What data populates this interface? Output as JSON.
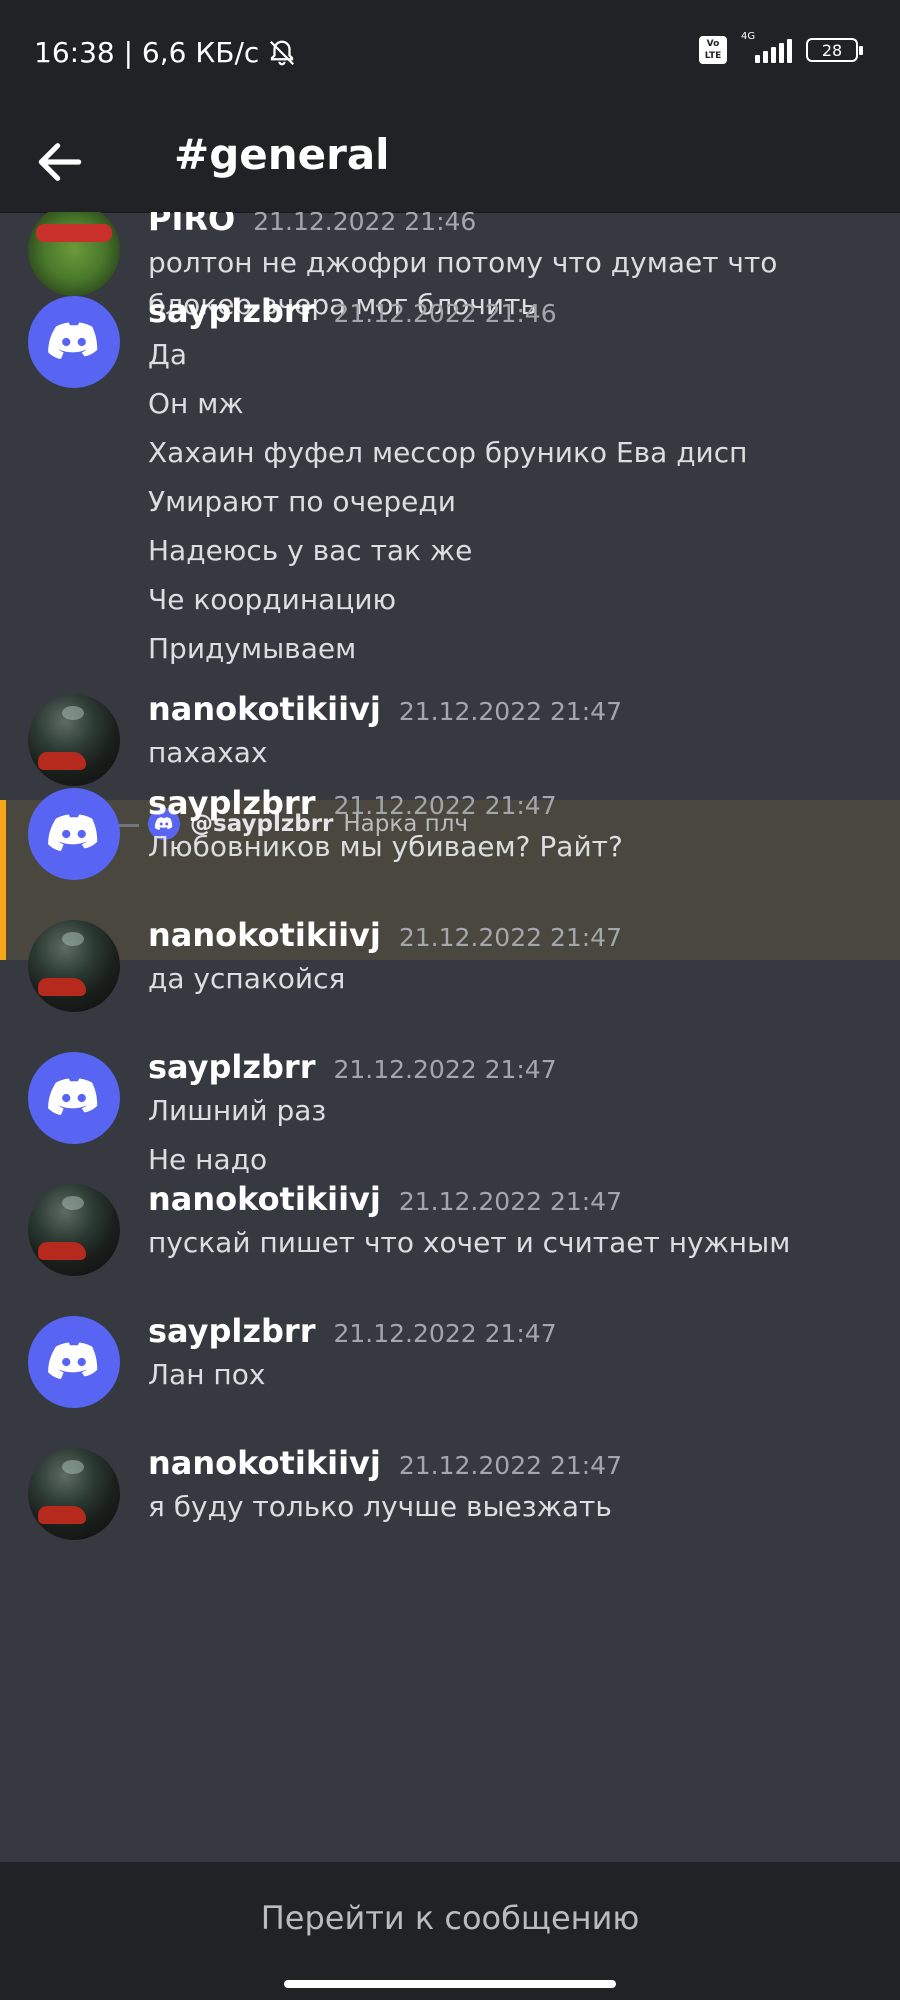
{
  "status_bar": {
    "time_speed": "16:38 | 6,6 КБ/с",
    "network": "4G",
    "volte": "Vo LTE",
    "battery": "28"
  },
  "header": {
    "channel": "#general"
  },
  "reply": {
    "user": "@sayplzbrr",
    "text": "Нарка плч"
  },
  "messages": [
    {
      "user": "PIRO",
      "time": "21.12.2022 21:46",
      "avatar": "piro-avatar",
      "lines": [
        "ролтон не джофри потому что думает что",
        "блокер вчера мог блочить"
      ]
    },
    {
      "user": "sayplzbrr",
      "time": "21.12.2022 21:46",
      "avatar": "discord-logo",
      "lines": [
        "Да",
        "Он мж",
        "Хахаин фуфел мессор брунико Ева дисп",
        "Умирают по очереди",
        "Надеюсь у вас так же",
        "Че координацию",
        "Придумываем"
      ]
    },
    {
      "user": "nanokotikiivj",
      "time": "21.12.2022 21:47",
      "avatar": "car-night-avatar",
      "lines": [
        "пахахах"
      ]
    },
    {
      "user": "sayplzbrr",
      "time": "21.12.2022 21:47",
      "avatar": "discord-logo",
      "lines": [
        "Любовников мы убиваем? Райт?"
      ]
    },
    {
      "user": "nanokotikiivj",
      "time": "21.12.2022 21:47",
      "avatar": "car-night-avatar",
      "lines": [
        "да успакойся"
      ]
    },
    {
      "user": "sayplzbrr",
      "time": "21.12.2022 21:47",
      "avatar": "discord-logo",
      "lines": [
        "Лишний раз",
        "Не надо"
      ]
    },
    {
      "user": "nanokotikiivj",
      "time": "21.12.2022 21:47",
      "avatar": "car-night-avatar",
      "lines": [
        "пускай пишет что хочет и считает нужным"
      ]
    },
    {
      "user": "sayplzbrr",
      "time": "21.12.2022 21:47",
      "avatar": "discord-logo",
      "lines": [
        "Лан пох"
      ]
    },
    {
      "user": "nanokotikiivj",
      "time": "21.12.2022 21:47",
      "avatar": "car-night-avatar",
      "lines": [
        "я буду только лучше выезжать"
      ]
    }
  ],
  "footer": {
    "jump_label": "Перейти к сообщению"
  },
  "colors": {
    "background": "#36393f",
    "bar": "#202225",
    "blurple": "#5865f2",
    "highlight": "#faa61a"
  }
}
